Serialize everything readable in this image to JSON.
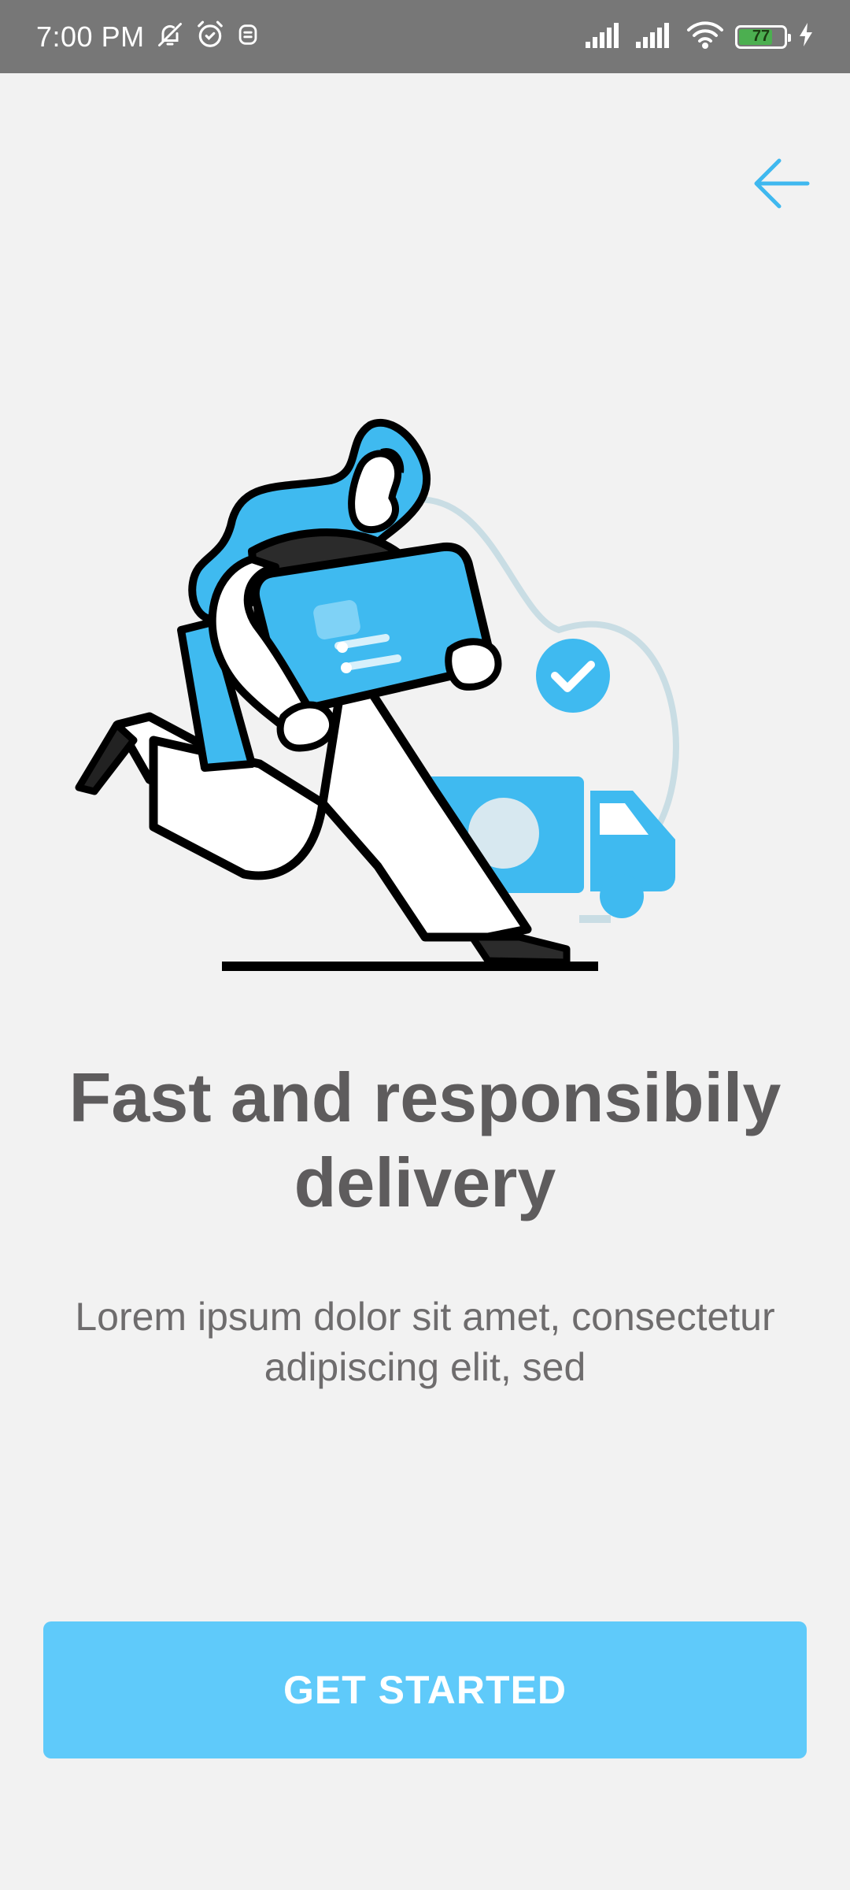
{
  "status_bar": {
    "time": "7:00 PM",
    "battery_level": "77",
    "icons": [
      "bell-off-icon",
      "alarm-icon",
      "notification-icon",
      "signal-icon",
      "signal-icon",
      "wifi-icon",
      "battery-icon",
      "charging-icon"
    ]
  },
  "nav": {
    "back_icon": "arrow-left-icon"
  },
  "illustration": {
    "name": "delivery-person-carrying-box-illustration"
  },
  "content": {
    "headline": "Fast and responsibily delivery",
    "subtitle": "Lorem ipsum dolor sit amet, consectetur adipiscing elit, sed"
  },
  "cta": {
    "label": "GET STARTED"
  },
  "colors": {
    "accent": "#5fcafa",
    "illustration_blue": "#3fbaf0",
    "text_dark": "#5e5c5d",
    "text_muted": "#6e6c6d",
    "background": "#f2f2f2",
    "status_bar": "#777777"
  }
}
